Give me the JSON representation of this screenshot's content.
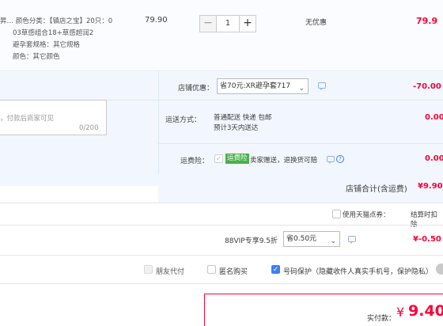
{
  "product": {
    "spec_line1": "昇…  颜色分类：【镇店之宝】20只：0",
    "spec_line2": "03草感组合18+草感超润2",
    "spec_line3": "避孕套规格：其它规格",
    "spec_line4": "颜色：其它颜色",
    "unit_price": "79.90",
    "quantity": "1",
    "minus": "−",
    "plus": "+",
    "discount": "无优惠",
    "row_total": "79.9"
  },
  "shop": {
    "message_placeholder": "，付款后商家可见",
    "message_count": "0/200",
    "coupon_label": "店铺优惠：",
    "coupon_value": "省70元:XR避孕套717",
    "coupon_caret": "⌄",
    "coupon_amount": "-70.00",
    "shipping_label": "运送方式：",
    "shipping_line1": "普通配送 快递 包邮",
    "shipping_line2": "预计3天内送达",
    "shipping_amount": "0.00",
    "insurance_label": "运费险：",
    "insurance_badge": "运费险",
    "insurance_text": "卖家赠送，退换货可赔",
    "insurance_check": "✓",
    "insurance_help": "?",
    "insurance_amount": "0.00",
    "store_total_label": "店铺合计(含运费)",
    "store_total_value": "¥9.90"
  },
  "points": {
    "tmall_points_label": "使用天猫点券：",
    "settle_label": "结算时扣除"
  },
  "vip": {
    "label": "88VIP专享9.5折",
    "select_value": "省0.50元",
    "caret": "⌄",
    "amount": "¥-0.50"
  },
  "options": {
    "friend_pay": "朋友代付",
    "anonymous": "匿名购买",
    "privacy": "号码保护（隐藏收件人真实手机号，保护隐私）",
    "privacy_check": "✓"
  },
  "payment": {
    "label": "实付款：",
    "currency": "¥",
    "amount": "9.40"
  }
}
